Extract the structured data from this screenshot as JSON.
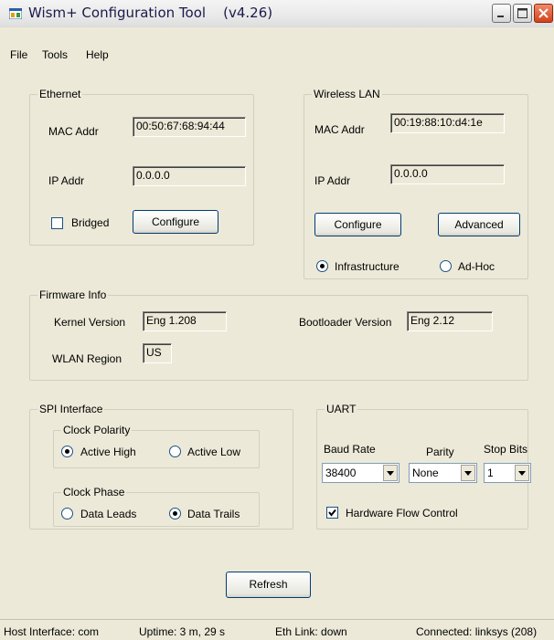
{
  "window": {
    "title": "Wism+ Configuration Tool    (v4.26)"
  },
  "menu": [
    "File",
    "Tools",
    "Help"
  ],
  "ethernet": {
    "legend": "Ethernet",
    "mac_label": "MAC Addr",
    "mac_value": "00:50:67:68:94:44",
    "ip_label": "IP Addr",
    "ip_value": "0.0.0.0",
    "bridged_label": "Bridged",
    "bridged_checked": false,
    "configure_label": "Configure"
  },
  "wlan": {
    "legend": "Wireless LAN",
    "mac_label": "MAC Addr",
    "mac_value": "00:19:88:10:d4:1e",
    "ip_label": "IP Addr",
    "ip_value": "0.0.0.0",
    "configure_label": "Configure",
    "advanced_label": "Advanced",
    "mode_options": [
      "Infrastructure",
      "Ad-Hoc"
    ],
    "mode_selected": "Infrastructure"
  },
  "firmware": {
    "legend": "Firmware Info",
    "kernel_label": "Kernel Version",
    "kernel_value": "Eng 1.208",
    "bootloader_label": "Bootloader Version",
    "bootloader_value": "Eng 2.12",
    "region_label": "WLAN Region",
    "region_value": "US"
  },
  "spi": {
    "legend": "SPI Interface",
    "polarity_legend": "Clock Polarity",
    "polarity_options": [
      "Active High",
      "Active Low"
    ],
    "polarity_selected": "Active High",
    "phase_legend": "Clock Phase",
    "phase_options": [
      "Data Leads",
      "Data Trails"
    ],
    "phase_selected": "Data Trails"
  },
  "uart": {
    "legend": "UART",
    "baud_label": "Baud Rate",
    "baud_value": "38400",
    "parity_label": "Parity",
    "parity_value": "None",
    "stop_label": "Stop Bits",
    "stop_value": "1",
    "flow_label": "Hardware Flow Control",
    "flow_checked": true
  },
  "refresh_label": "Refresh",
  "status": {
    "host": "Host Interface: com",
    "uptime": "Uptime: 3 m, 29 s",
    "eth_link": "Eth Link: down",
    "connected": "Connected: linksys (208)"
  }
}
